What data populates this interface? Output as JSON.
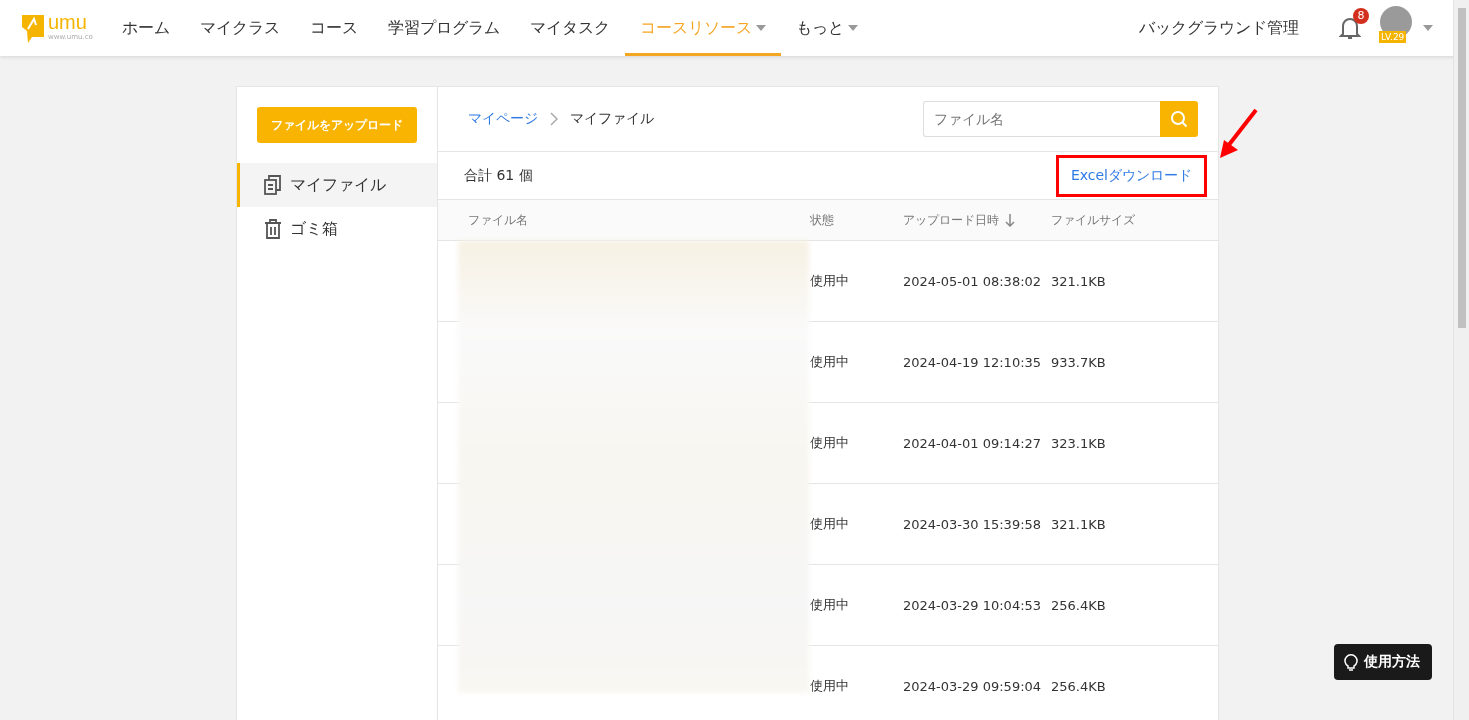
{
  "header": {
    "logo": {
      "name": "umu",
      "url": "www.umu.co"
    },
    "nav": [
      {
        "label": "ホーム",
        "selected": false,
        "dropdown": false
      },
      {
        "label": "マイクラス",
        "selected": false,
        "dropdown": false
      },
      {
        "label": "コース",
        "selected": false,
        "dropdown": false
      },
      {
        "label": "学習プログラム",
        "selected": false,
        "dropdown": false
      },
      {
        "label": "マイタスク",
        "selected": false,
        "dropdown": false
      },
      {
        "label": "コースリソース",
        "selected": true,
        "dropdown": true
      },
      {
        "label": "もっと",
        "selected": false,
        "dropdown": true
      }
    ],
    "admin_link": "バックグラウンド管理",
    "notification_count": "8",
    "level": "LV.29"
  },
  "sidebar": {
    "upload_button": "ファイルをアップロード",
    "items": [
      {
        "label": "マイファイル",
        "kind": "files",
        "selected": true
      },
      {
        "label": "ゴミ箱",
        "kind": "trash",
        "selected": false
      }
    ]
  },
  "breadcrumb": [
    {
      "label": "マイページ",
      "link": true
    },
    {
      "label": "マイファイル",
      "link": false
    }
  ],
  "search": {
    "placeholder": "ファイル名"
  },
  "total": "合計 61 個",
  "excel_download": "Excelダウンロード",
  "table": {
    "columns": [
      {
        "label": "ファイル名",
        "sort": false
      },
      {
        "label": "状態",
        "sort": false
      },
      {
        "label": "アップロード日時",
        "sort": true
      },
      {
        "label": "ファイルサイズ",
        "sort": false
      }
    ],
    "rows": [
      {
        "status": "使用中",
        "uploaded": "2024-05-01 08:38:02",
        "size": "321.1KB"
      },
      {
        "status": "使用中",
        "uploaded": "2024-04-19 12:10:35",
        "size": "933.7KB"
      },
      {
        "status": "使用中",
        "uploaded": "2024-04-01 09:14:27",
        "size": "323.1KB"
      },
      {
        "status": "使用中",
        "uploaded": "2024-03-30 15:39:58",
        "size": "321.1KB"
      },
      {
        "status": "使用中",
        "uploaded": "2024-03-29 10:04:53",
        "size": "256.4KB"
      },
      {
        "status": "使用中",
        "uploaded": "2024-03-29 09:59:04",
        "size": "256.4KB"
      }
    ]
  },
  "help_button": "使用方法"
}
